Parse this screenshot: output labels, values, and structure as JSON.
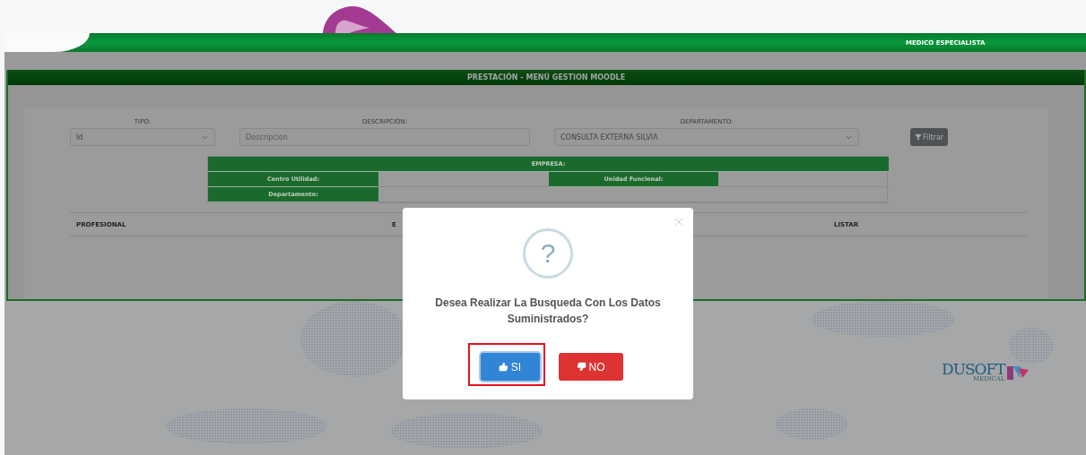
{
  "header": {
    "role": "MEDICO ESPECIALISTA"
  },
  "panel": {
    "title": "PRESTACIÓN - MENÚ GESTION MOODLE",
    "filters": [
      {
        "kind": "select",
        "label": "TIPO:",
        "value": "Id"
      },
      {
        "kind": "text",
        "label": "DESCRIPCIÓN:",
        "placeholder": "Descripcion"
      },
      {
        "kind": "select",
        "label": "DEPARTAMENTO:",
        "value": "CONSULTA EXTERNA SILVIA"
      }
    ],
    "filter_button": "Filtrar",
    "company": {
      "title": "EMPRESA:",
      "labels": [
        "Centro Utilidad:",
        "Unidad Funcional:",
        "Departamento:"
      ]
    },
    "list_columns": [
      "PROFESIONAL",
      "E",
      "LISTAR"
    ]
  },
  "dialog": {
    "icon_text": "?",
    "message": "Desea Realizar La Busqueda Con Los Datos Suministrados?",
    "buttons": [
      {
        "kind": "confirm",
        "label": "SI",
        "highlighted": true
      },
      {
        "kind": "cancel",
        "label": "NO",
        "highlighted": false
      }
    ]
  },
  "logo": {
    "name": "DUSOFT",
    "tagline": "MEDICAL"
  }
}
